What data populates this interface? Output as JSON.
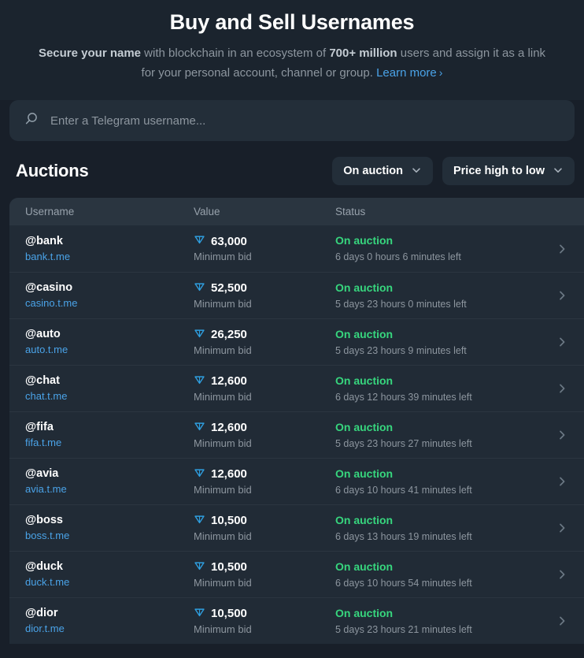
{
  "hero": {
    "title": "Buy and Sell Usernames",
    "sub_bold_1": "Secure your name",
    "sub_text_1": " with blockchain in an ecosystem of ",
    "sub_bold_2": "700+ million",
    "sub_text_2": " users and assign it as a link for your personal account, channel or group. ",
    "learn_more": "Learn more",
    "learn_more_chevron": "›"
  },
  "search": {
    "placeholder": "Enter a Telegram username...",
    "value": "",
    "icon": "search-icon"
  },
  "section": {
    "title": "Auctions",
    "filters": [
      {
        "label": "On auction",
        "icon": "chevron-down-icon"
      },
      {
        "label": "Price high to low",
        "icon": "chevron-down-icon"
      }
    ]
  },
  "table": {
    "columns": [
      "Username",
      "Value",
      "Status"
    ],
    "value_subtitle": "Minimum bid",
    "currency_icon": "ton-diamond-icon",
    "row_arrow_icon": "chevron-right-icon",
    "rows": [
      {
        "username": "@bank",
        "link": "bank.t.me",
        "value": "63,000",
        "value_sub": "Minimum bid",
        "status": "On auction",
        "time_left": "6 days 0 hours 6 minutes left"
      },
      {
        "username": "@casino",
        "link": "casino.t.me",
        "value": "52,500",
        "value_sub": "Minimum bid",
        "status": "On auction",
        "time_left": "5 days 23 hours 0 minutes left"
      },
      {
        "username": "@auto",
        "link": "auto.t.me",
        "value": "26,250",
        "value_sub": "Minimum bid",
        "status": "On auction",
        "time_left": "5 days 23 hours 9 minutes left"
      },
      {
        "username": "@chat",
        "link": "chat.t.me",
        "value": "12,600",
        "value_sub": "Minimum bid",
        "status": "On auction",
        "time_left": "6 days 12 hours 39 minutes left"
      },
      {
        "username": "@fifa",
        "link": "fifa.t.me",
        "value": "12,600",
        "value_sub": "Minimum bid",
        "status": "On auction",
        "time_left": "5 days 23 hours 27 minutes left"
      },
      {
        "username": "@avia",
        "link": "avia.t.me",
        "value": "12,600",
        "value_sub": "Minimum bid",
        "status": "On auction",
        "time_left": "6 days 10 hours 41 minutes left"
      },
      {
        "username": "@boss",
        "link": "boss.t.me",
        "value": "10,500",
        "value_sub": "Minimum bid",
        "status": "On auction",
        "time_left": "6 days 13 hours 19 minutes left"
      },
      {
        "username": "@duck",
        "link": "duck.t.me",
        "value": "10,500",
        "value_sub": "Minimum bid",
        "status": "On auction",
        "time_left": "6 days 10 hours 54 minutes left"
      },
      {
        "username": "@dior",
        "link": "dior.t.me",
        "value": "10,500",
        "value_sub": "Minimum bid",
        "status": "On auction",
        "time_left": "5 days 23 hours 21 minutes left"
      }
    ]
  },
  "colors": {
    "page_bg": "#181f29",
    "hero_bg": "#1b242e",
    "card_bg": "#212b36",
    "header_row_bg": "#2a3540",
    "accent_blue": "#4aa3e8",
    "accent_green": "#37d67e",
    "muted_text": "#8d969f",
    "ton_blue": "#2f9fe0"
  }
}
